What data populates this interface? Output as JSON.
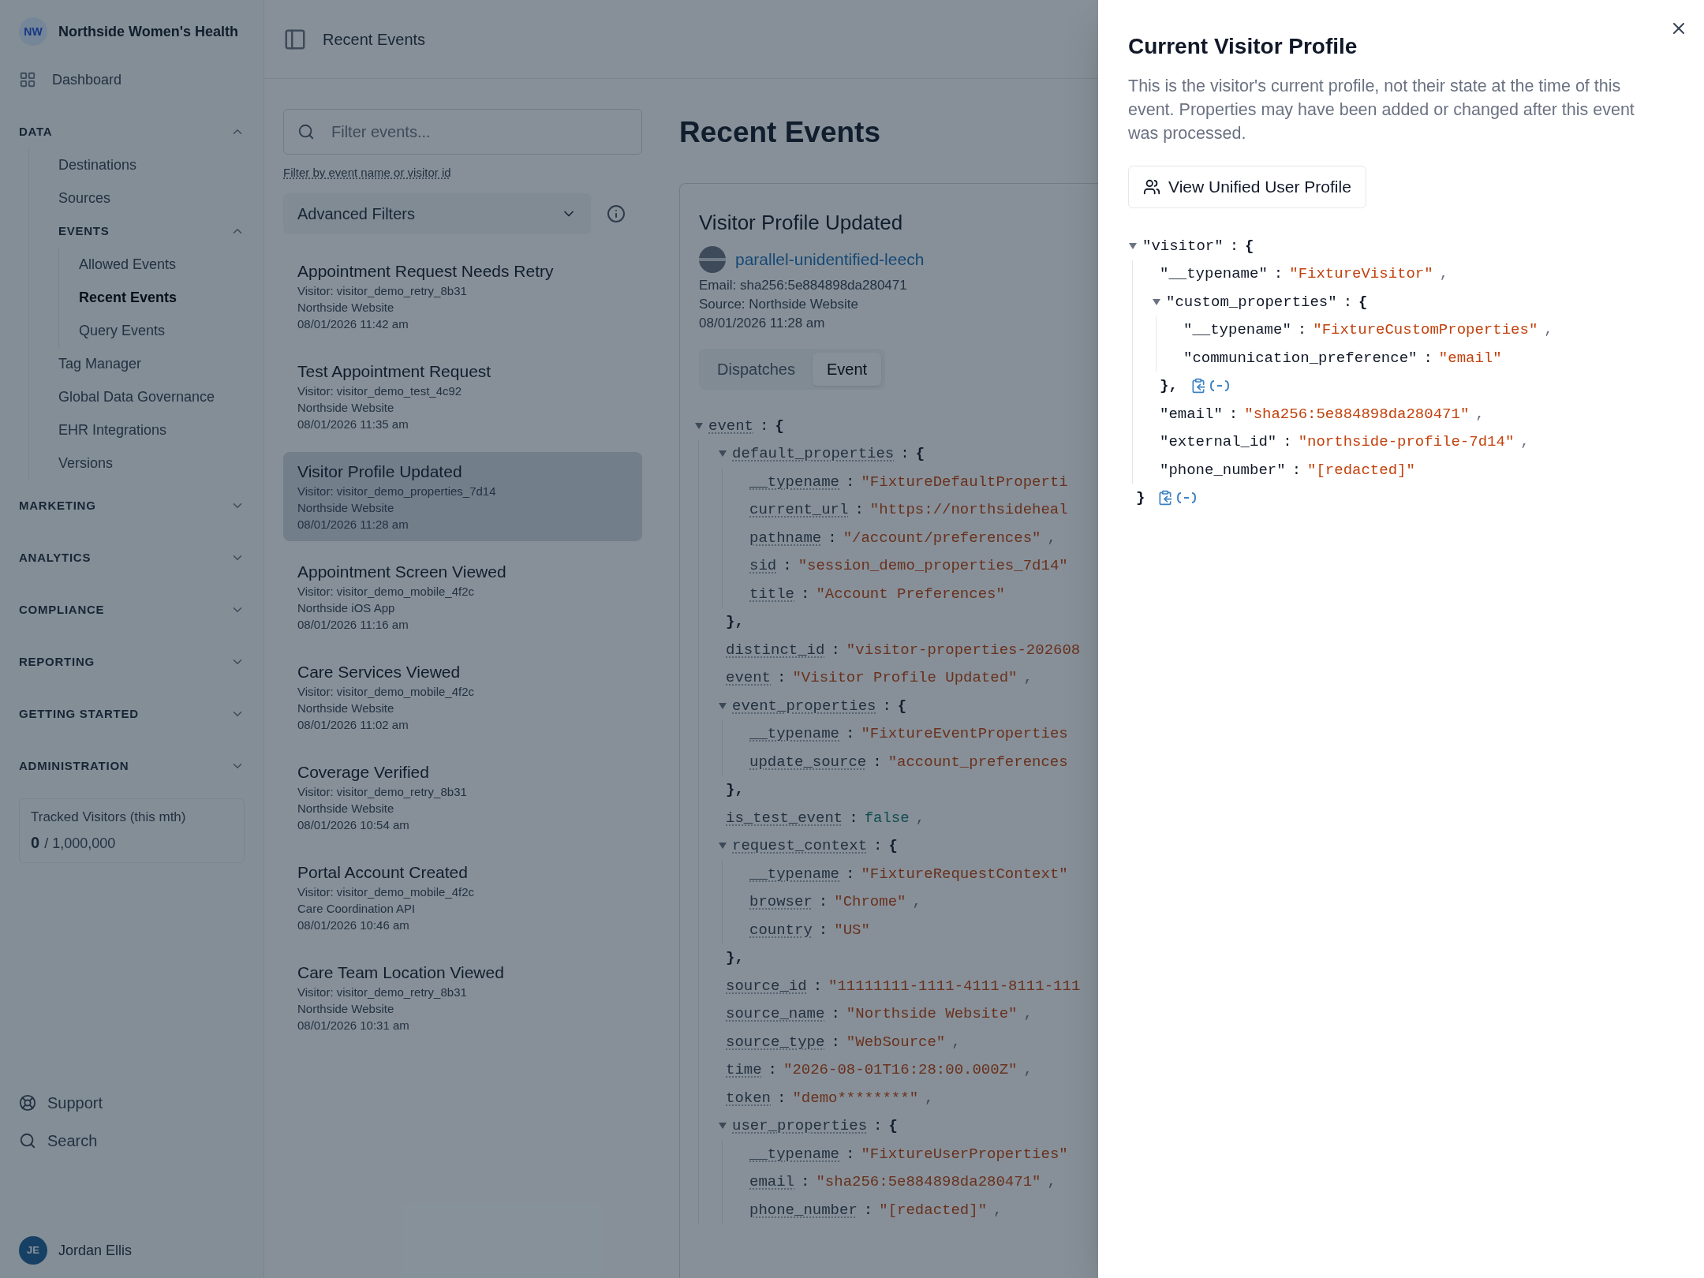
{
  "sidebar": {
    "brand": {
      "initials": "NW",
      "name": "Northside Women's Health"
    },
    "top_items": [
      {
        "label": "Dashboard",
        "selected": false
      }
    ],
    "sections": [
      {
        "label": "DATA",
        "expanded": true,
        "items": [
          {
            "kind": "link",
            "label": "Destinations",
            "selected": false
          },
          {
            "kind": "link",
            "label": "Sources",
            "selected": false
          },
          {
            "kind": "group",
            "label": "EVENTS",
            "expanded": true,
            "children": [
              {
                "label": "Allowed Events",
                "selected": false
              },
              {
                "label": "Recent Events",
                "selected": true
              },
              {
                "label": "Query Events",
                "selected": false
              }
            ]
          },
          {
            "kind": "link",
            "label": "Tag Manager",
            "selected": false
          },
          {
            "kind": "link",
            "label": "Global Data Governance",
            "selected": false
          },
          {
            "kind": "link",
            "label": "EHR Integrations",
            "selected": false
          },
          {
            "kind": "link",
            "label": "Versions",
            "selected": false
          }
        ]
      },
      {
        "label": "MARKETING",
        "expanded": false
      },
      {
        "label": "ANALYTICS",
        "expanded": false
      },
      {
        "label": "COMPLIANCE",
        "expanded": false
      },
      {
        "label": "REPORTING",
        "expanded": false
      },
      {
        "label": "GETTING STARTED",
        "expanded": false
      },
      {
        "label": "ADMINISTRATION",
        "expanded": false
      }
    ],
    "usage": {
      "label": "Tracked Visitors (this mth)",
      "count": "0",
      "total": "/ 1,000,000"
    },
    "footer_items": [
      {
        "kind": "support",
        "label": "Support"
      },
      {
        "kind": "search",
        "label": "Search"
      }
    ],
    "user": {
      "initials": "JE",
      "name": "Jordan Ellis"
    }
  },
  "header": {
    "title": "Recent Events"
  },
  "filters": {
    "placeholder": "Filter events...",
    "hint": "Filter by event name or visitor id",
    "advanced": "Advanced Filters"
  },
  "events": [
    {
      "title": "Appointment Request Needs Retry",
      "visitor": "Visitor: visitor_demo_retry_8b31",
      "source": "Northside Website",
      "time": "08/01/2026 11:42 am",
      "selected": false
    },
    {
      "title": "Test Appointment Request",
      "visitor": "Visitor: visitor_demo_test_4c92",
      "source": "Northside Website",
      "time": "08/01/2026 11:35 am",
      "selected": false
    },
    {
      "title": "Visitor Profile Updated",
      "visitor": "Visitor: visitor_demo_properties_7d14",
      "source": "Northside Website",
      "time": "08/01/2026 11:28 am",
      "selected": true
    },
    {
      "title": "Appointment Screen Viewed",
      "visitor": "Visitor: visitor_demo_mobile_4f2c",
      "source": "Northside iOS App",
      "time": "08/01/2026 11:16 am",
      "selected": false
    },
    {
      "title": "Care Services Viewed",
      "visitor": "Visitor: visitor_demo_mobile_4f2c",
      "source": "Northside Website",
      "time": "08/01/2026 11:02 am",
      "selected": false
    },
    {
      "title": "Coverage Verified",
      "visitor": "Visitor: visitor_demo_retry_8b31",
      "source": "Northside Website",
      "time": "08/01/2026 10:54 am",
      "selected": false
    },
    {
      "title": "Portal Account Created",
      "visitor": "Visitor: visitor_demo_mobile_4f2c",
      "source": "Care Coordination API",
      "time": "08/01/2026 10:46 am",
      "selected": false
    },
    {
      "title": "Care Team Location Viewed",
      "visitor": "Visitor: visitor_demo_retry_8b31",
      "source": "Northside Website",
      "time": "08/01/2026 10:31 am",
      "selected": false
    }
  ],
  "page_title": "Recent Events",
  "detail": {
    "title": "Visitor Profile Updated",
    "visitor_name": "parallel-unidentified-leech",
    "email": "Email: sha256:5e884898da280471",
    "source": "Source: Northside Website",
    "time": "08/01/2026 11:28 am",
    "tabs": [
      {
        "label": "Dispatches",
        "selected": false
      },
      {
        "label": "Event",
        "selected": true
      }
    ],
    "tree": [
      {
        "key": "event",
        "sep": ":",
        "open": "{",
        "expanded": true,
        "children": [
          {
            "key": "default_properties",
            "sep": ":",
            "open": "{",
            "expanded": true,
            "close": "},",
            "children": [
              {
                "key": "__typename",
                "sep": ":",
                "kind": "string",
                "value": "\"FixtureDefaultProperti"
              },
              {
                "key": "current_url",
                "sep": ":",
                "kind": "string",
                "value": "\"https://northsideheal"
              },
              {
                "key": "pathname",
                "sep": ":",
                "kind": "string",
                "value": "\"/account/preferences\"",
                "suffix": ","
              },
              {
                "key": "sid",
                "sep": ":",
                "kind": "string",
                "value": "\"session_demo_properties_7d14\""
              },
              {
                "key": "title",
                "sep": ":",
                "kind": "string",
                "value": "\"Account Preferences\""
              }
            ]
          },
          {
            "key": "distinct_id",
            "sep": ":",
            "kind": "string",
            "value": "\"visitor-properties-202608"
          },
          {
            "key": "event",
            "sep": ":",
            "kind": "string",
            "value": "\"Visitor Profile Updated\"",
            "suffix": ","
          },
          {
            "key": "event_properties",
            "sep": ":",
            "open": "{",
            "expanded": true,
            "close": "},",
            "children": [
              {
                "key": "__typename",
                "sep": ":",
                "kind": "string",
                "value": "\"FixtureEventProperties"
              },
              {
                "key": "update_source",
                "sep": ":",
                "kind": "string",
                "value": "\"account_preferences"
              }
            ]
          },
          {
            "key": "is_test_event",
            "sep": ":",
            "kind": "boolean",
            "value": "false",
            "suffix": ","
          },
          {
            "key": "request_context",
            "sep": ":",
            "open": "{",
            "expanded": true,
            "close": "},",
            "children": [
              {
                "key": "__typename",
                "sep": ":",
                "kind": "string",
                "value": "\"FixtureRequestContext\""
              },
              {
                "key": "browser",
                "sep": ":",
                "kind": "string",
                "value": "\"Chrome\"",
                "suffix": ","
              },
              {
                "key": "country",
                "sep": ":",
                "kind": "string",
                "value": "\"US\""
              }
            ]
          },
          {
            "key": "source_id",
            "sep": ":",
            "kind": "string",
            "value": "\"11111111-1111-4111-8111-111"
          },
          {
            "key": "source_name",
            "sep": ":",
            "kind": "string",
            "value": "\"Northside Website\"",
            "suffix": ","
          },
          {
            "key": "source_type",
            "sep": ":",
            "kind": "string",
            "value": "\"WebSource\"",
            "suffix": ","
          },
          {
            "key": "time",
            "sep": ":",
            "kind": "string",
            "value": "\"2026-08-01T16:28:00.000Z\"",
            "suffix": ","
          },
          {
            "key": "token",
            "sep": ":",
            "kind": "string",
            "value": "\"demo********\"",
            "suffix": ","
          },
          {
            "key": "user_properties",
            "sep": ":",
            "open": "{",
            "expanded": true,
            "children": [
              {
                "key": "__typename",
                "sep": ":",
                "kind": "string",
                "value": "\"FixtureUserProperties\""
              },
              {
                "key": "email",
                "sep": ":",
                "kind": "string",
                "value": "\"sha256:5e884898da280471\"",
                "suffix": ","
              },
              {
                "key": "phone_number",
                "sep": ":",
                "kind": "string",
                "value": "\"[redacted]\"",
                "suffix": ","
              }
            ]
          }
        ]
      }
    ]
  },
  "drawer": {
    "title": "Current Visitor Profile",
    "description": "This is the visitor's current profile, not their state at the time of this event. Properties may have been added or changed after this event was processed.",
    "button": "View Unified User Profile",
    "tree": [
      {
        "key": "\"visitor\"",
        "sep": ":",
        "open": "{",
        "expanded": true,
        "close": "}",
        "children": [
          {
            "key": "\"__typename\"",
            "sep": ":",
            "kind": "string",
            "value": "\"FixtureVisitor\"",
            "suffix": ","
          },
          {
            "key": "\"custom_properties\"",
            "sep": ":",
            "open": "{",
            "expanded": true,
            "close": "},",
            "children": [
              {
                "key": "\"__typename\"",
                "sep": ":",
                "kind": "string",
                "value": "\"FixtureCustomProperties\"",
                "suffix": ","
              },
              {
                "key": "\"communication_preference\"",
                "sep": ":",
                "kind": "string",
                "value": "\"email\""
              }
            ]
          },
          {
            "key": "\"email\"",
            "sep": ":",
            "kind": "string",
            "value": "\"sha256:5e884898da280471\"",
            "suffix": ","
          },
          {
            "key": "\"external_id\"",
            "sep": ":",
            "kind": "string",
            "value": "\"northside-profile-7d14\"",
            "suffix": ","
          },
          {
            "key": "\"phone_number\"",
            "sep": ":",
            "kind": "string",
            "value": "\"[redacted]\""
          }
        ]
      }
    ]
  }
}
